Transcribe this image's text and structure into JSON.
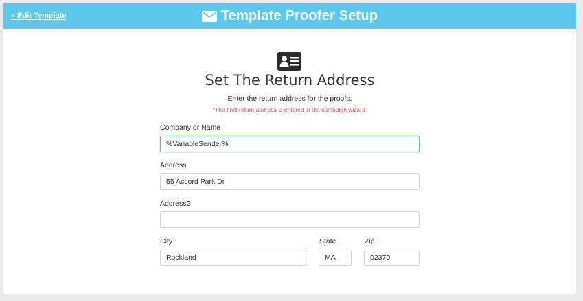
{
  "header": {
    "back_label": "« Edit Template",
    "title": "Template Proofer Setup"
  },
  "section": {
    "title": "Set The Return Address",
    "subtitle": "Enter the return address for the proofs.",
    "note": "*The final return address is entered in the campaign wizard."
  },
  "form": {
    "company": {
      "label": "Company or Name",
      "value": "%VariableSender%"
    },
    "address": {
      "label": "Address",
      "value": "55 Accord Park Dr"
    },
    "address2": {
      "label": "Address2",
      "value": ""
    },
    "city": {
      "label": "City",
      "value": "Rockland"
    },
    "state": {
      "label": "State",
      "value": "MA"
    },
    "zip": {
      "label": "Zip",
      "value": "02370"
    }
  },
  "colors": {
    "header_bg": "#5bc8ec",
    "note_text": "#d9534f",
    "focus_border": "#66afe9"
  },
  "icons": {
    "title_icon": "envelope-icon",
    "section_icon": "address-card-icon"
  }
}
